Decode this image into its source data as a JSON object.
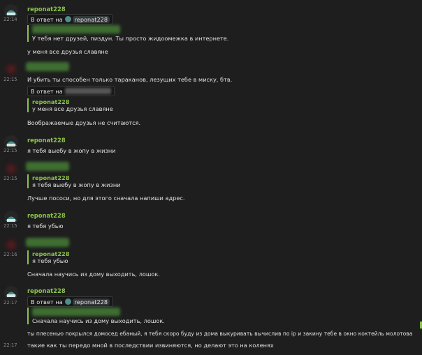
{
  "colors": {
    "background": "#1e1e1e",
    "username": "#8bc34a",
    "timestamp": "#8a8a8a",
    "text": "#e0e0e0"
  },
  "messages": [
    {
      "author": "reponat228",
      "time": "22:14",
      "reply_label": "В ответ на",
      "reply_user": "reponat228",
      "quote": "У тебя нет друзей, пиздун. Ты просто жидоомежка в интернете.",
      "text": "у меня все друзья славяне"
    },
    {
      "time": "22:15",
      "text": "И убить ты способен только тараканов, лезущих тебе в миску, бтв.",
      "reply_label": "В ответ на",
      "quote_author": "reponat228",
      "quote": "у меня все друзья славяне",
      "text2": "Воображаемые друзья не считаются."
    },
    {
      "author": "reponat228",
      "time": "22:15",
      "text": "я тебя выебу в жопу в жизни"
    },
    {
      "time": "22:15",
      "quote_author": "reponat228",
      "quote": "я тебя выебу в жопу в жизни",
      "text": "Лучше пососи, но для этого сначала напиши адрес."
    },
    {
      "author": "reponat228",
      "time": "22:15",
      "text": "я тебя убью"
    },
    {
      "time": "22:16",
      "quote_author": "reponat228",
      "quote": "я тебя убью",
      "text": "Сначала научись из дому выходить, лошок."
    },
    {
      "author": "reponat228",
      "time": "22:17",
      "reply_label": "В ответ на",
      "reply_user": "reponat228",
      "quote": "Сначала научись из дому выходить, лошок.",
      "text": "ты плесенью покрылся домосед ебаный, я тебя скоро буду из дома выкуривать вычислив по ip и закину тебе в окно коктейль молотова",
      "time2": "22:17",
      "text2": "такие как ты передо мной в последствии извиняются, но делают это на коленях"
    }
  ]
}
